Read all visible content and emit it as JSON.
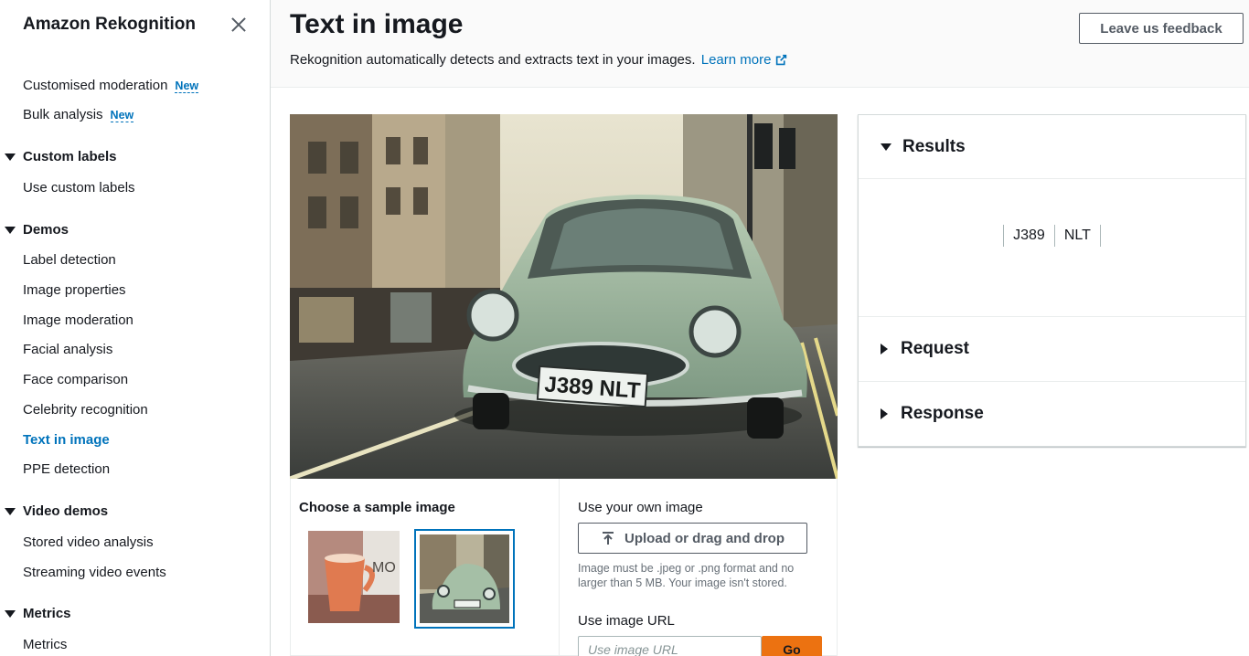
{
  "sidebar": {
    "title": "Amazon Rekognition",
    "top_items": [
      {
        "label": "Customised moderation",
        "badge": "New"
      },
      {
        "label": "Bulk analysis",
        "badge": "New"
      }
    ],
    "sections": {
      "custom_labels": {
        "title": "Custom labels",
        "items": [
          "Use custom labels"
        ]
      },
      "demos": {
        "title": "Demos",
        "items": [
          "Label detection",
          "Image properties",
          "Image moderation",
          "Facial analysis",
          "Face comparison",
          "Celebrity recognition",
          "Text in image",
          "PPE detection"
        ],
        "active": "Text in image"
      },
      "video_demos": {
        "title": "Video demos",
        "items": [
          "Stored video analysis",
          "Streaming video events"
        ]
      },
      "metrics": {
        "title": "Metrics",
        "items": [
          "Metrics"
        ]
      }
    }
  },
  "header": {
    "title": "Text in image",
    "description": "Rekognition automatically detects and extracts text in your images.",
    "learn_more": "Learn more",
    "feedback_button": "Leave us feedback"
  },
  "hero": {
    "plate_text": "J389 NLT"
  },
  "chooser": {
    "sample_title": "Choose a sample image",
    "own_title": "Use your own image",
    "upload_label": "Upload or drag and drop",
    "upload_hint": "Image must be .jpeg or .png format and no larger than 5 MB. Your image isn't stored.",
    "url_title": "Use image URL",
    "url_placeholder": "Use image URL",
    "go_label": "Go",
    "thumb1_text": "MO"
  },
  "results": {
    "sections": [
      "Results",
      "Request",
      "Response"
    ],
    "tokens": [
      "J389",
      "NLT"
    ]
  },
  "colors": {
    "accent": "#0073bb",
    "go_button": "#ec7211"
  }
}
